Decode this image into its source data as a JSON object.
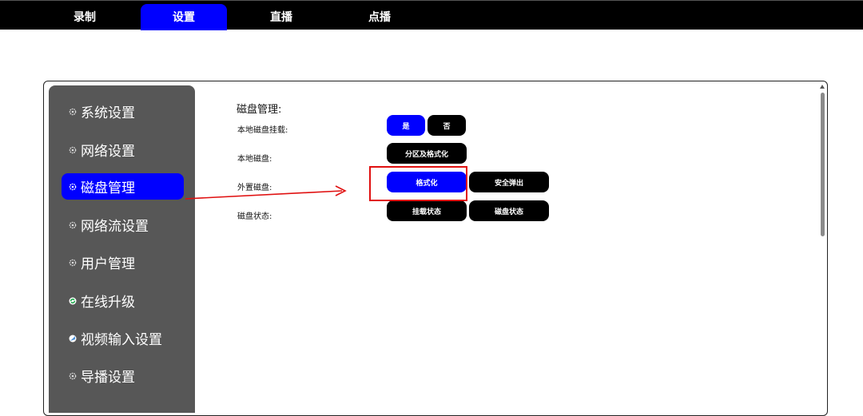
{
  "nav": {
    "tabs": [
      {
        "label": "录制"
      },
      {
        "label": "设置"
      },
      {
        "label": "直播"
      },
      {
        "label": "点播"
      }
    ]
  },
  "sidebar": {
    "items": [
      {
        "label": "系统设置",
        "icon": "settings-icon"
      },
      {
        "label": "网络设置",
        "icon": "settings-icon"
      },
      {
        "label": "磁盘管理",
        "icon": "settings-icon"
      },
      {
        "label": "网络流设置",
        "icon": "settings-icon"
      },
      {
        "label": "用户管理",
        "icon": "settings-icon"
      },
      {
        "label": "在线升级",
        "icon": "refresh-icon"
      },
      {
        "label": "视频输入设置",
        "icon": "video-input-icon"
      },
      {
        "label": "导播设置",
        "icon": "settings-icon"
      }
    ]
  },
  "disk": {
    "title": "磁盘管理:",
    "rows": [
      {
        "label": "本地磁盘挂载:"
      },
      {
        "label": "本地磁盘:"
      },
      {
        "label": "外置磁盘:"
      },
      {
        "label": "磁盘状态:"
      }
    ],
    "mount_yes": "是",
    "mount_no": "否",
    "partition_format": "分区及格式化",
    "format": "格式化",
    "safe_eject": "安全弹出",
    "mount_status": "挂载状态",
    "disk_status": "磁盘状态"
  },
  "colors": {
    "accent": "#0000ff",
    "annotation": "#e01010",
    "sidebar_bg": "#575757"
  }
}
